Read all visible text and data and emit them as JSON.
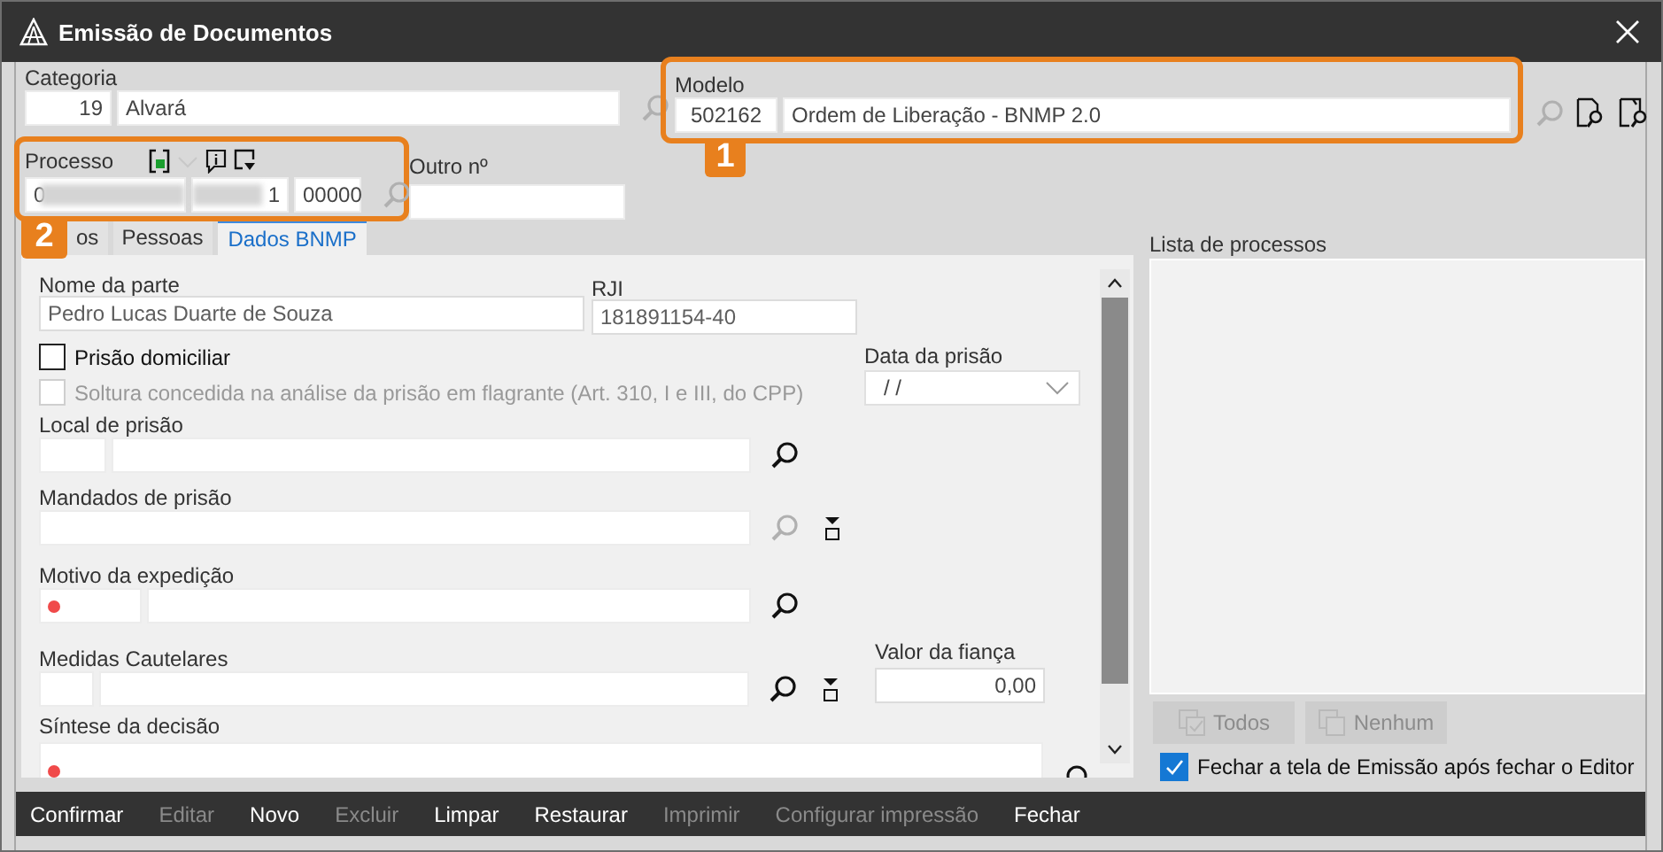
{
  "window": {
    "title": "Emissão de Documentos"
  },
  "categoria": {
    "label": "Categoria",
    "code": "19",
    "name": "Alvará",
    "lookup_disabled": true
  },
  "modelo": {
    "label": "Modelo",
    "code": "502162",
    "name": "Ordem de Liberação - BNMP 2.0",
    "lookup_disabled": true,
    "callout": "1"
  },
  "processo": {
    "label": "Processo",
    "lookup_disabled": true,
    "callout": "2",
    "segments": [
      {
        "value": "0",
        "redacted": true
      },
      {
        "value": "1",
        "redacted": true
      },
      {
        "value": "00000",
        "redacted": false
      }
    ]
  },
  "outro_numero": {
    "label": "Outro nº"
  },
  "tabs": [
    {
      "label": "os",
      "selected": false
    },
    {
      "label": "Pessoas",
      "selected": false
    },
    {
      "label": "Dados BNMP",
      "selected": true
    }
  ],
  "form": {
    "nome_da_parte": {
      "label": "Nome da parte",
      "value": "Pedro Lucas Duarte de Souza"
    },
    "rji": {
      "label": "RJI",
      "value": "181891154-40"
    },
    "checks": [
      {
        "label": "Prisão domiciliar",
        "checked": false,
        "disabled": false
      },
      {
        "label": "Soltura concedida na análise da prisão em flagrante (Art. 310, I e III, do CPP)",
        "checked": false,
        "disabled": true
      }
    ],
    "data_da_prisao": {
      "label": "Data da prisão",
      "value": "/ /"
    },
    "local_de_prisao": {
      "label": "Local de prisão",
      "lookup_disabled": false
    },
    "mandados_de_prisao": {
      "label": "Mandados de prisão",
      "lookup_disabled": true
    },
    "motivo_da_expedicao": {
      "label": "Motivo da expedição",
      "required": true,
      "lookup_disabled": false
    },
    "medidas_cautelares": {
      "label": "Medidas Cautelares",
      "lookup_disabled": false
    },
    "valor_da_fianca": {
      "label": "Valor da fiança",
      "value": "0,00"
    },
    "sintese_da_decisao": {
      "label": "Síntese da decisão",
      "required": true
    }
  },
  "lista": {
    "title": "Lista de processos",
    "buttons": [
      {
        "label": "Todos",
        "kind": "all",
        "disabled": true
      },
      {
        "label": "Nenhum",
        "kind": "none",
        "disabled": true
      }
    ],
    "close_option": {
      "label": "Fechar a tela de Emissão após fechar o Editor",
      "checked": true
    }
  },
  "actions": [
    {
      "label": "Confirmar",
      "disabled": false
    },
    {
      "label": "Editar",
      "disabled": true
    },
    {
      "label": "Novo",
      "disabled": false
    },
    {
      "label": "Excluir",
      "disabled": true
    },
    {
      "label": "Limpar",
      "disabled": false
    },
    {
      "label": "Restaurar",
      "disabled": false
    },
    {
      "label": "Imprimir",
      "disabled": true
    },
    {
      "label": "Configurar impressão",
      "disabled": true
    },
    {
      "label": "Fechar",
      "disabled": false
    }
  ]
}
